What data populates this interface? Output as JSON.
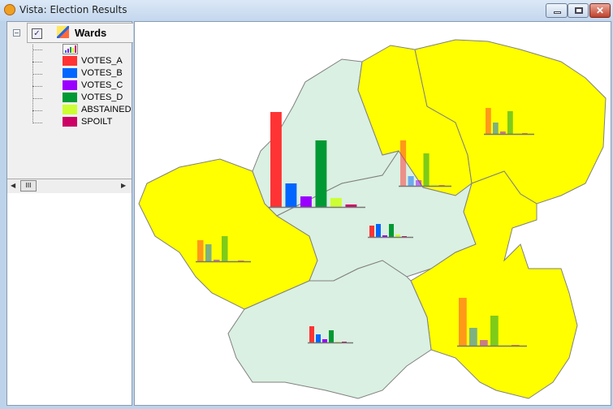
{
  "window": {
    "title": "Vista: Election Results",
    "icon": "app-globe-icon",
    "buttons": [
      "minimize",
      "maximize",
      "close"
    ]
  },
  "layer": {
    "name": "Wards",
    "checked": true,
    "expanded": true,
    "legend": [
      {
        "label": "VOTES_A",
        "color": "#ff3333"
      },
      {
        "label": "VOTES_B",
        "color": "#0066ff"
      },
      {
        "label": "VOTES_C",
        "color": "#9900ff"
      },
      {
        "label": "VOTES_D",
        "color": "#009933"
      },
      {
        "label": "ABSTAINED",
        "color": "#ccff33"
      },
      {
        "label": "SPOILT",
        "color": "#cc0066"
      }
    ]
  },
  "map": {
    "colors": {
      "yellow": "#ffff00",
      "green": "#daf0e2",
      "border": "#808080"
    },
    "wards": [
      {
        "fill": "yellow",
        "values": [
          26,
          21,
          2,
          31,
          1,
          1
        ]
      },
      {
        "fill": "green",
        "values": [
          117,
          29,
          13,
          82,
          11,
          3
        ]
      },
      {
        "fill": "yellow",
        "values": [
          56,
          12,
          7,
          40,
          2,
          1
        ]
      },
      {
        "fill": "yellow",
        "values": [
          32,
          14,
          3,
          28,
          1,
          1
        ]
      },
      {
        "fill": "green",
        "values": [
          14,
          16,
          2,
          16,
          3,
          1
        ]
      },
      {
        "fill": "yellow",
        "values": [
          59,
          22,
          7,
          37,
          1,
          1
        ]
      },
      {
        "fill": "green",
        "values": [
          20,
          10,
          4,
          15,
          1,
          1
        ]
      }
    ]
  }
}
